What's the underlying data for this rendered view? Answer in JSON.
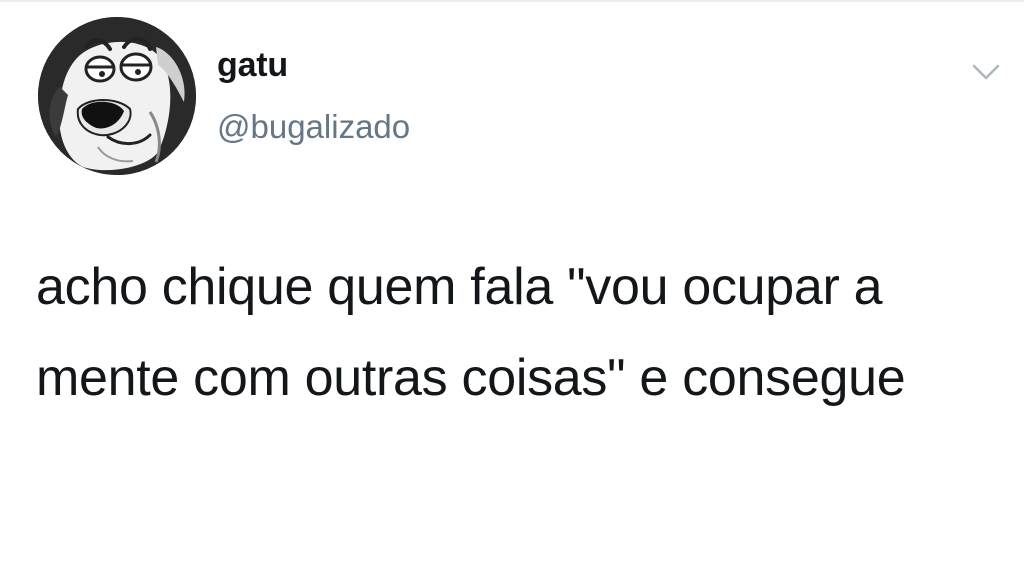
{
  "tweet": {
    "author": {
      "display_name": "gatu",
      "handle": "@bugalizado"
    },
    "text": "acho chique quem fala \"vou ocupar a mente com outras coisas\" e consegue",
    "menu_icon": "chevron-down-icon",
    "avatar_icon": "cartoon-dog-avatar"
  },
  "colors": {
    "text_primary": "#14171a",
    "text_secondary": "#657786",
    "icon": "#aab8c2",
    "background": "#ffffff"
  }
}
